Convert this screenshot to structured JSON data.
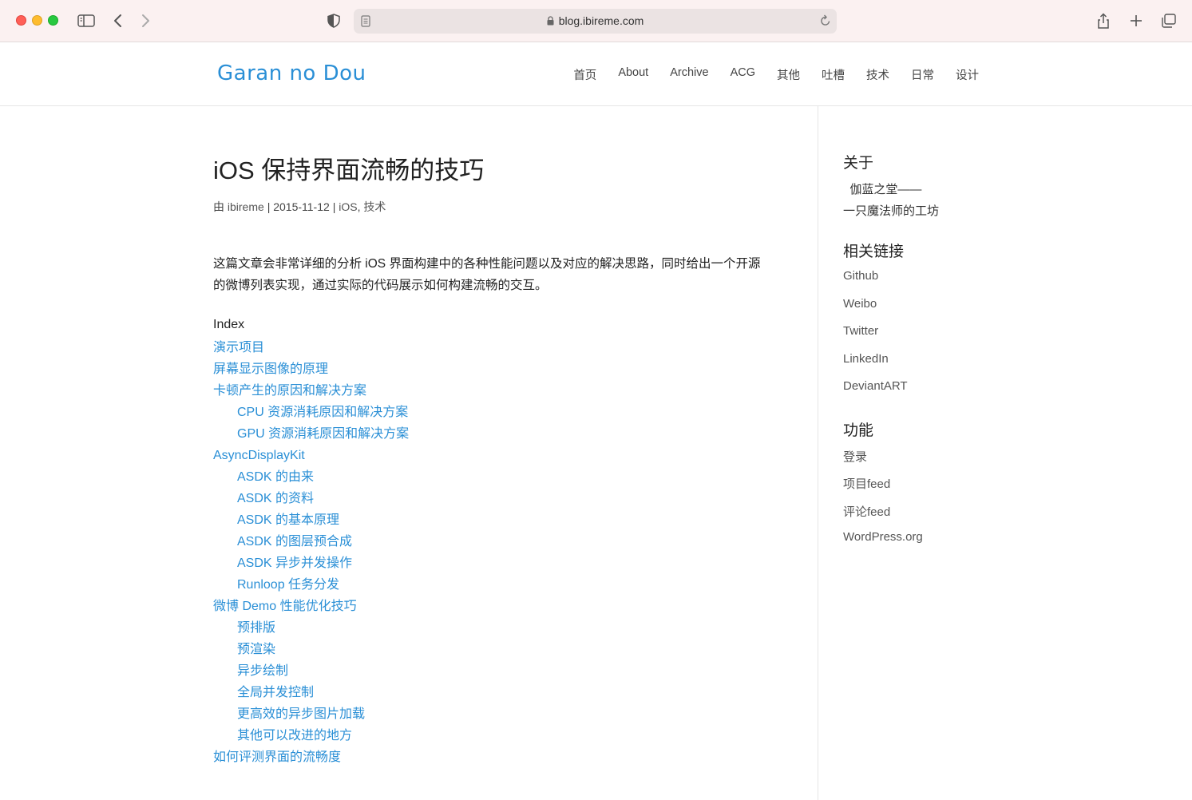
{
  "browser": {
    "url": "blog.ibireme.com"
  },
  "site": {
    "logo": "Garan no Dou",
    "nav": [
      "首页",
      "About",
      "Archive",
      "ACG",
      "其他",
      "吐槽",
      "技术",
      "日常",
      "设计"
    ]
  },
  "post": {
    "title": "iOS 保持界面流畅的技巧",
    "meta": {
      "by": "由",
      "author": "ibireme",
      "sep1": "|",
      "date": "2015-11-12",
      "sep2": "|",
      "category1": "iOS",
      "comma": ",",
      "category2": "技术"
    },
    "intro": "这篇文章会非常详细的分析 iOS 界面构建中的各种性能问题以及对应的解决思路，同时给出一个开源的微博列表实现，通过实际的代码展示如何构建流畅的交互。",
    "index_title": "Index",
    "toc": [
      {
        "label": "演示项目",
        "level": 1
      },
      {
        "label": "屏幕显示图像的原理",
        "level": 1
      },
      {
        "label": "卡顿产生的原因和解决方案",
        "level": 1
      },
      {
        "label": "CPU 资源消耗原因和解决方案",
        "level": 2
      },
      {
        "label": "GPU 资源消耗原因和解决方案",
        "level": 2
      },
      {
        "label": "AsyncDisplayKit",
        "level": 1
      },
      {
        "label": "ASDK 的由来",
        "level": 2
      },
      {
        "label": "ASDK 的资料",
        "level": 2
      },
      {
        "label": "ASDK 的基本原理",
        "level": 2
      },
      {
        "label": "ASDK 的图层预合成",
        "level": 2
      },
      {
        "label": "ASDK 异步并发操作",
        "level": 2
      },
      {
        "label": "Runloop 任务分发",
        "level": 2
      },
      {
        "label": "微博 Demo 性能优化技巧",
        "level": 1
      },
      {
        "label": "预排版",
        "level": 2
      },
      {
        "label": "预渲染",
        "level": 2
      },
      {
        "label": "异步绘制",
        "level": 2
      },
      {
        "label": "全局并发控制",
        "level": 2
      },
      {
        "label": "更高效的异步图片加载",
        "level": 2
      },
      {
        "label": "其他可以改进的地方",
        "level": 2
      },
      {
        "label": "如何评测界面的流畅度",
        "level": 1
      }
    ]
  },
  "sidebar": {
    "about": {
      "title": "关于",
      "line1": "  伽蓝之堂——",
      "line2": "一只魔法师的工坊"
    },
    "links": {
      "title": "相关链接",
      "items": [
        "Github",
        "Weibo",
        "Twitter",
        "LinkedIn",
        "DeviantART"
      ]
    },
    "functions": {
      "title": "功能",
      "items": [
        "登录",
        "项目feed",
        "评论feed",
        "WordPress.org"
      ]
    }
  }
}
